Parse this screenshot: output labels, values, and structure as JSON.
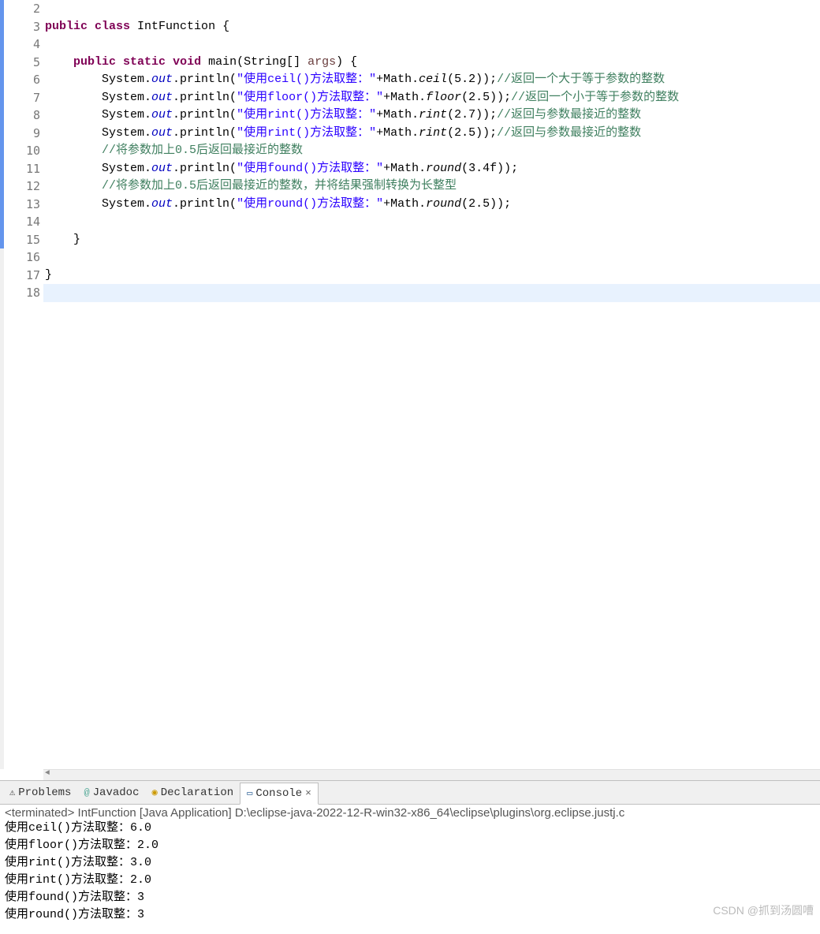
{
  "gutter": {
    "start": 2,
    "end": 18,
    "override_line": 5
  },
  "code": {
    "lines": [
      {
        "n": 2,
        "blue": true,
        "html": ""
      },
      {
        "n": 3,
        "blue": true,
        "segs": [
          {
            "t": "public",
            "c": "kw"
          },
          {
            "t": " "
          },
          {
            "t": "class",
            "c": "kw"
          },
          {
            "t": " IntFunction {"
          }
        ]
      },
      {
        "n": 4,
        "blue": true,
        "html": ""
      },
      {
        "n": 5,
        "blue": true,
        "segs": [
          {
            "t": "    "
          },
          {
            "t": "public",
            "c": "kw"
          },
          {
            "t": " "
          },
          {
            "t": "static",
            "c": "kw"
          },
          {
            "t": " "
          },
          {
            "t": "void",
            "c": "kw"
          },
          {
            "t": " main(String[] "
          },
          {
            "t": "args",
            "c": "arg"
          },
          {
            "t": ") {"
          }
        ]
      },
      {
        "n": 6,
        "blue": true,
        "segs": [
          {
            "t": "        System."
          },
          {
            "t": "out",
            "c": "static-field"
          },
          {
            "t": ".println("
          },
          {
            "t": "\"使用ceil()方法取整：\"",
            "c": "str"
          },
          {
            "t": "+Math."
          },
          {
            "t": "ceil",
            "c": "method-it"
          },
          {
            "t": "(5.2));"
          },
          {
            "t": "//返回一个大于等于参数的整数",
            "c": "cmt"
          }
        ]
      },
      {
        "n": 7,
        "blue": true,
        "segs": [
          {
            "t": "        System."
          },
          {
            "t": "out",
            "c": "static-field"
          },
          {
            "t": ".println("
          },
          {
            "t": "\"使用floor()方法取整：\"",
            "c": "str"
          },
          {
            "t": "+Math."
          },
          {
            "t": "floor",
            "c": "method-it"
          },
          {
            "t": "(2.5));"
          },
          {
            "t": "//返回一个小于等于参数的整数",
            "c": "cmt"
          }
        ]
      },
      {
        "n": 8,
        "blue": true,
        "segs": [
          {
            "t": "        System."
          },
          {
            "t": "out",
            "c": "static-field"
          },
          {
            "t": ".println("
          },
          {
            "t": "\"使用rint()方法取整：\"",
            "c": "str"
          },
          {
            "t": "+Math."
          },
          {
            "t": "rint",
            "c": "method-it"
          },
          {
            "t": "(2.7));"
          },
          {
            "t": "//返回与参数最接近的整数",
            "c": "cmt"
          }
        ]
      },
      {
        "n": 9,
        "blue": true,
        "segs": [
          {
            "t": "        System."
          },
          {
            "t": "out",
            "c": "static-field"
          },
          {
            "t": ".println("
          },
          {
            "t": "\"使用rint()方法取整：\"",
            "c": "str"
          },
          {
            "t": "+Math."
          },
          {
            "t": "rint",
            "c": "method-it"
          },
          {
            "t": "(2.5));"
          },
          {
            "t": "//返回与参数最接近的整数",
            "c": "cmt"
          }
        ]
      },
      {
        "n": 10,
        "blue": true,
        "segs": [
          {
            "t": "        "
          },
          {
            "t": "//将参数加上0.5后返回最接近的整数",
            "c": "cmt"
          }
        ]
      },
      {
        "n": 11,
        "blue": true,
        "segs": [
          {
            "t": "        System."
          },
          {
            "t": "out",
            "c": "static-field"
          },
          {
            "t": ".println("
          },
          {
            "t": "\"使用found()方法取整：\"",
            "c": "str"
          },
          {
            "t": "+Math."
          },
          {
            "t": "round",
            "c": "method-it"
          },
          {
            "t": "(3.4f));"
          }
        ]
      },
      {
        "n": 12,
        "blue": true,
        "segs": [
          {
            "t": "        "
          },
          {
            "t": "//将参数加上0.5后返回最接近的整数，并将结果强制转换为长整型",
            "c": "cmt"
          }
        ]
      },
      {
        "n": 13,
        "blue": true,
        "segs": [
          {
            "t": "        System."
          },
          {
            "t": "out",
            "c": "static-field"
          },
          {
            "t": ".println("
          },
          {
            "t": "\"使用round()方法取整：\"",
            "c": "str"
          },
          {
            "t": "+Math."
          },
          {
            "t": "round",
            "c": "method-it"
          },
          {
            "t": "(2.5));"
          }
        ]
      },
      {
        "n": 14,
        "blue": true,
        "html": ""
      },
      {
        "n": 15,
        "blue": true,
        "segs": [
          {
            "t": "    }"
          }
        ]
      },
      {
        "n": 16,
        "html": ""
      },
      {
        "n": 17,
        "segs": [
          {
            "t": "}"
          }
        ]
      },
      {
        "n": 18,
        "current": true,
        "html": ""
      }
    ]
  },
  "tabs": {
    "problems": "Problems",
    "javadoc": "Javadoc",
    "declaration": "Declaration",
    "console": "Console"
  },
  "console": {
    "status": "<terminated> IntFunction [Java Application] D:\\eclipse-java-2022-12-R-win32-x86_64\\eclipse\\plugins\\org.eclipse.justj.c",
    "output": [
      "使用ceil()方法取整：6.0",
      "使用floor()方法取整：2.0",
      "使用rint()方法取整：3.0",
      "使用rint()方法取整：2.0",
      "使用found()方法取整：3",
      "使用round()方法取整：3"
    ]
  },
  "watermark": "CSDN @抓到汤圆嘈"
}
